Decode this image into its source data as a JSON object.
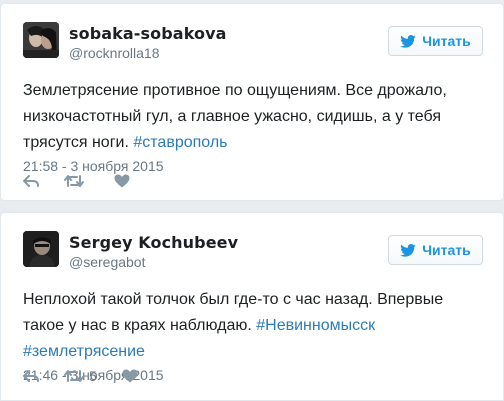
{
  "colors": {
    "hashtag": "#2b7bb9",
    "follow_text": "#1b95e0",
    "meta_gray": "#697882",
    "icon_gray": "#8899a6"
  },
  "tweets": [
    {
      "display_name": "sobaka-sobakova",
      "screen_name": "@rocknrolla18",
      "follow_label": "Читать",
      "text_plain": "Землетрясение противное по ощущениям. Все дрожало, низкочастотный гул, а главное ужасно, сидишь, а у тебя трясутся ноги. ",
      "hashtags": [
        "#ставрополь"
      ],
      "timestamp": "21:58 - 3 ноября 2015",
      "retweet_count": "",
      "icons": {
        "reply": "reply-icon",
        "retweet": "retweet-icon",
        "like": "heart-icon",
        "follow": "twitter-bird-icon"
      }
    },
    {
      "display_name": "Sergey Kochubeev",
      "screen_name": "@seregabot",
      "follow_label": "Читать",
      "text_plain": "Неплохой такой толчок был где-то с час назад. Впервые такое у нас в краях наблюдаю. ",
      "hashtags": [
        "#Невинномысск",
        "#землетрясение"
      ],
      "timestamp": "21:46 - 3 ноября 2015",
      "retweet_count": "5",
      "icons": {
        "reply": "reply-icon",
        "retweet": "retweet-icon",
        "like": "heart-icon",
        "follow": "twitter-bird-icon"
      }
    }
  ]
}
